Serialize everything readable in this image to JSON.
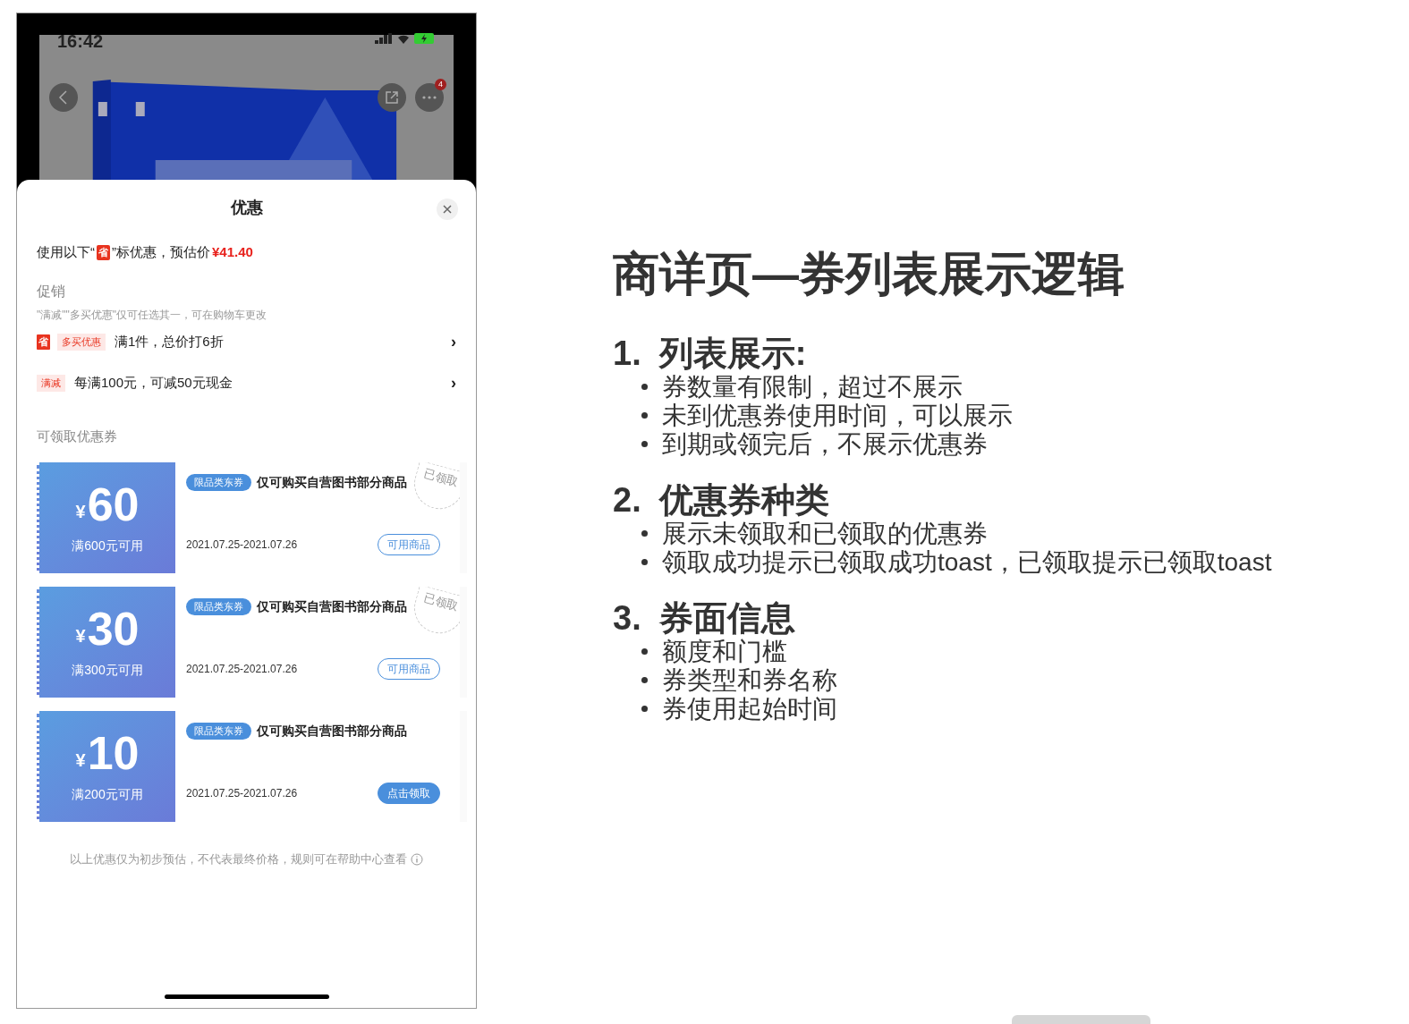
{
  "phone": {
    "status_bar": {
      "time": "16:42"
    },
    "more_badge": "4",
    "sheet": {
      "title": "优惠",
      "intro": {
        "before": "使用以下“",
        "mark": "省",
        "after": "”标优惠，预估价",
        "price": "¥41.40"
      },
      "promotions": {
        "heading": "促销",
        "note": "\"满减\"\"多买优惠\"仅可任选其一，可在购物车更改",
        "items": [
          {
            "save_mark": "省",
            "tag": "多买优惠",
            "text": "满1件，总价打6折",
            "chevron": "›"
          },
          {
            "tag": "满减",
            "text": "每满100元，可减50元现金",
            "chevron": "›"
          }
        ]
      },
      "coupons_heading": "可领取优惠券",
      "coupons": [
        {
          "symbol": "¥",
          "amount": "60",
          "condition": "满600元可用",
          "tag": "限品类东券",
          "name": "仅可购买自营图书部分商品",
          "date": "2021.07.25-2021.07.26",
          "button": "可用商品",
          "claimed": true,
          "stamp": "已领取"
        },
        {
          "symbol": "¥",
          "amount": "30",
          "condition": "满300元可用",
          "tag": "限品类东券",
          "name": "仅可购买自营图书部分商品",
          "date": "2021.07.25-2021.07.26",
          "button": "可用商品",
          "claimed": true,
          "stamp": "已领取"
        },
        {
          "symbol": "¥",
          "amount": "10",
          "condition": "满200元可用",
          "tag": "限品类东券",
          "name": "仅可购买自营图书部分商品",
          "date": "2021.07.25-2021.07.26",
          "button": "点击领取",
          "claimed": false
        }
      ],
      "footer": "以上优惠仅为初步预估，不代表最终价格，规则可在帮助中心查看"
    }
  },
  "notes": {
    "title": "商详页—券列表展示逻辑",
    "sections": [
      {
        "number": "1.",
        "heading": "列表展示:",
        "bullets": [
          "券数量有限制，超过不展示",
          "未到优惠券使用时间，可以展示",
          "到期或领完后，不展示优惠券"
        ]
      },
      {
        "number": "2.",
        "heading": "优惠券种类",
        "bullets": [
          "展示未领取和已领取的优惠券",
          "领取成功提示已领取成功toast，已领取提示已领取toast"
        ]
      },
      {
        "number": "3.",
        "heading": "券面信息",
        "bullets": [
          "额度和门槛",
          "券类型和券名称",
          "券使用起始时间"
        ]
      }
    ]
  }
}
